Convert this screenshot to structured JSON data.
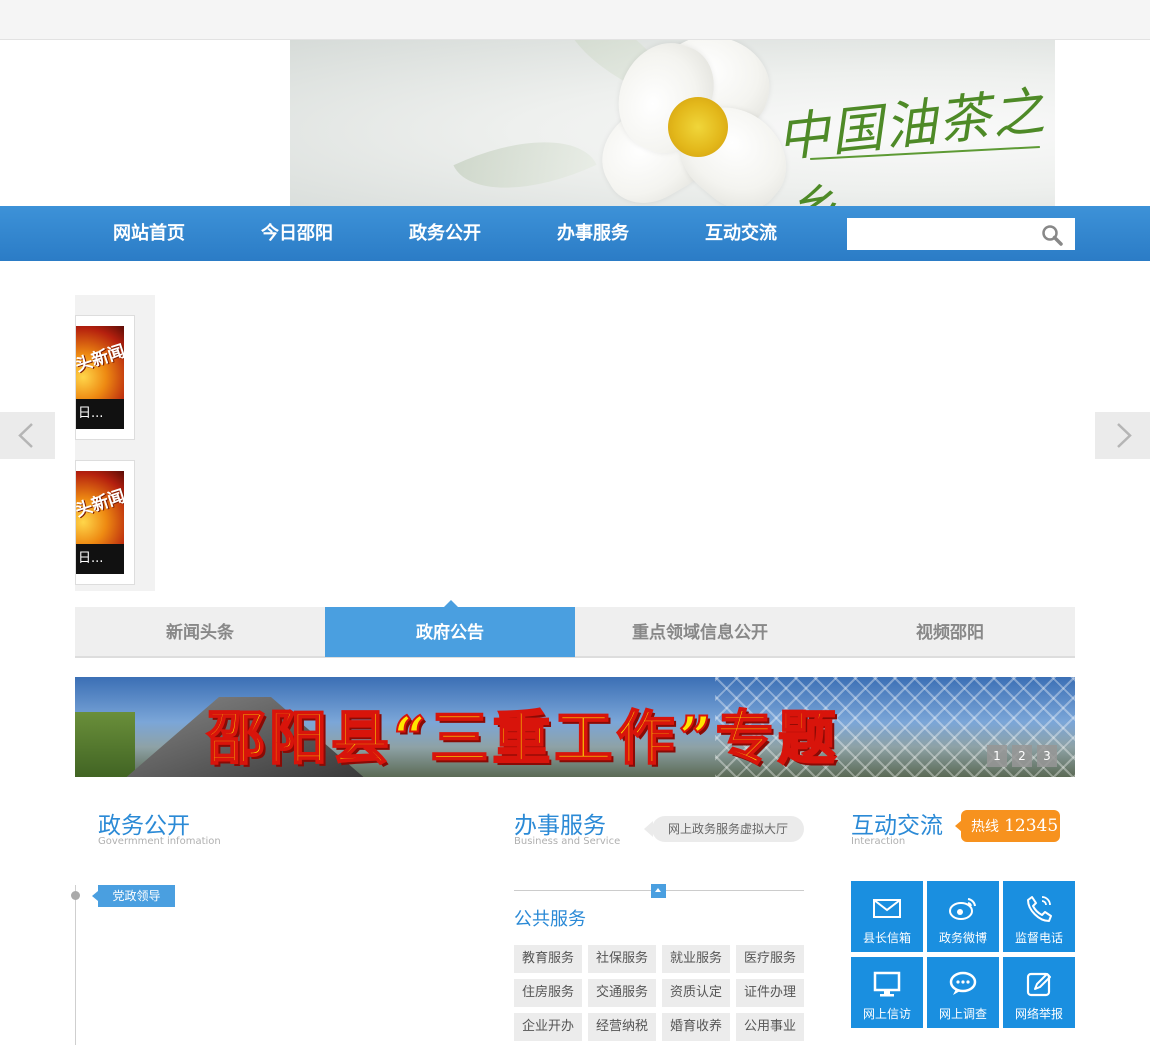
{
  "header": {
    "slogan": "中国油茶之乡"
  },
  "nav": {
    "items": [
      "网站首页",
      "今日邵阳",
      "政务公开",
      "办事服务",
      "互动交流"
    ],
    "search_placeholder": ""
  },
  "slider": {
    "thumbs": [
      {
        "image_text": "头新闻",
        "caption": "日..."
      },
      {
        "image_text": "头新闻",
        "caption": "日..."
      }
    ]
  },
  "tabs": {
    "items": [
      "新闻头条",
      "政府公告",
      "重点领域信息公开",
      "视频邵阳"
    ],
    "active_index": 1
  },
  "promo": {
    "title": "邵阳县“三重工作”专题",
    "pages": [
      "1",
      "2",
      "3"
    ]
  },
  "zwgk": {
    "title": "政务公开",
    "subtitle": "Govermment infomation",
    "badge": "党政领导"
  },
  "bsfw": {
    "title": "办事服务",
    "subtitle": "Business and Service",
    "hall_link": "网上政务服务虚拟大厅",
    "public_title": "公共服务",
    "services": [
      "教育服务",
      "社保服务",
      "就业服务",
      "医疗服务",
      "住房服务",
      "交通服务",
      "资质认定",
      "证件办理",
      "企业开办",
      "经营纳税",
      "婚育收养",
      "公用事业"
    ]
  },
  "hdjl": {
    "title": "互动交流",
    "subtitle": "Interaction",
    "hotline_label": "热线",
    "hotline_number": "12345",
    "tiles": [
      {
        "label": "县长信箱",
        "icon": "mail-icon"
      },
      {
        "label": "政务微博",
        "icon": "weibo-icon"
      },
      {
        "label": "监督电话",
        "icon": "phone-icon"
      },
      {
        "label": "网上信访",
        "icon": "monitor-icon"
      },
      {
        "label": "网上调查",
        "icon": "chat-icon"
      },
      {
        "label": "网络举报",
        "icon": "edit-icon"
      }
    ]
  },
  "colors": {
    "nav": "#2b7cc6",
    "accent": "#4a9fe0",
    "tile": "#1a8fe0",
    "hotline": "#f7921e"
  }
}
